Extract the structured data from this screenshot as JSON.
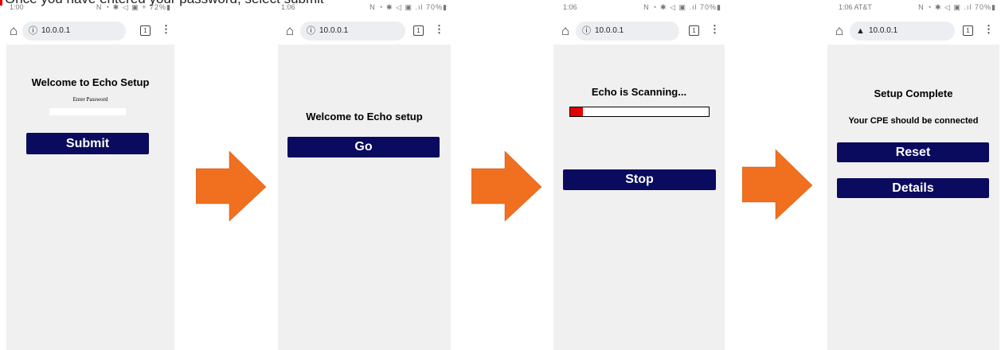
{
  "header_text": "Once you have entered your password, select submit",
  "screens": [
    {
      "time": "1:00",
      "status_icons": "N ◔ ✱ ◁ ▣ + 72%▮",
      "url": "10.0.0.1",
      "tab_count": "1",
      "title": "Welcome to Echo Setup",
      "password_label": "Enter Password",
      "password_value": "",
      "button_label": "Submit"
    },
    {
      "time": "1:06",
      "status_icons": "N ◔ ✱ ◁ ▣ .ıl 70%▮",
      "url": "10.0.0.1",
      "tab_count": "1",
      "title": "Welcome to Echo setup",
      "button_label": "Go"
    },
    {
      "time": "1:06",
      "status_icons": "N ◔ ✱ ◁ ▣ .ıl 70%▮",
      "url": "10.0.0.1",
      "tab_count": "1",
      "title": "Echo is Scanning...",
      "progress": 0.09,
      "progress_color": "#e00000",
      "button_label": "Stop"
    },
    {
      "time": "1:06 AT&T",
      "status_icons": "N ◔ ✱ ◁ ▣ .ıl 70%▮",
      "url": "10.0.0.1",
      "tab_count": "1",
      "title": "Setup Complete",
      "message": "Your CPE should be connected",
      "button_reset": "Reset",
      "button_details": "Details"
    }
  ],
  "colors": {
    "button_bg": "#0a0a5e",
    "arrow": "#f07020",
    "content_bg": "#f0f0f0"
  }
}
